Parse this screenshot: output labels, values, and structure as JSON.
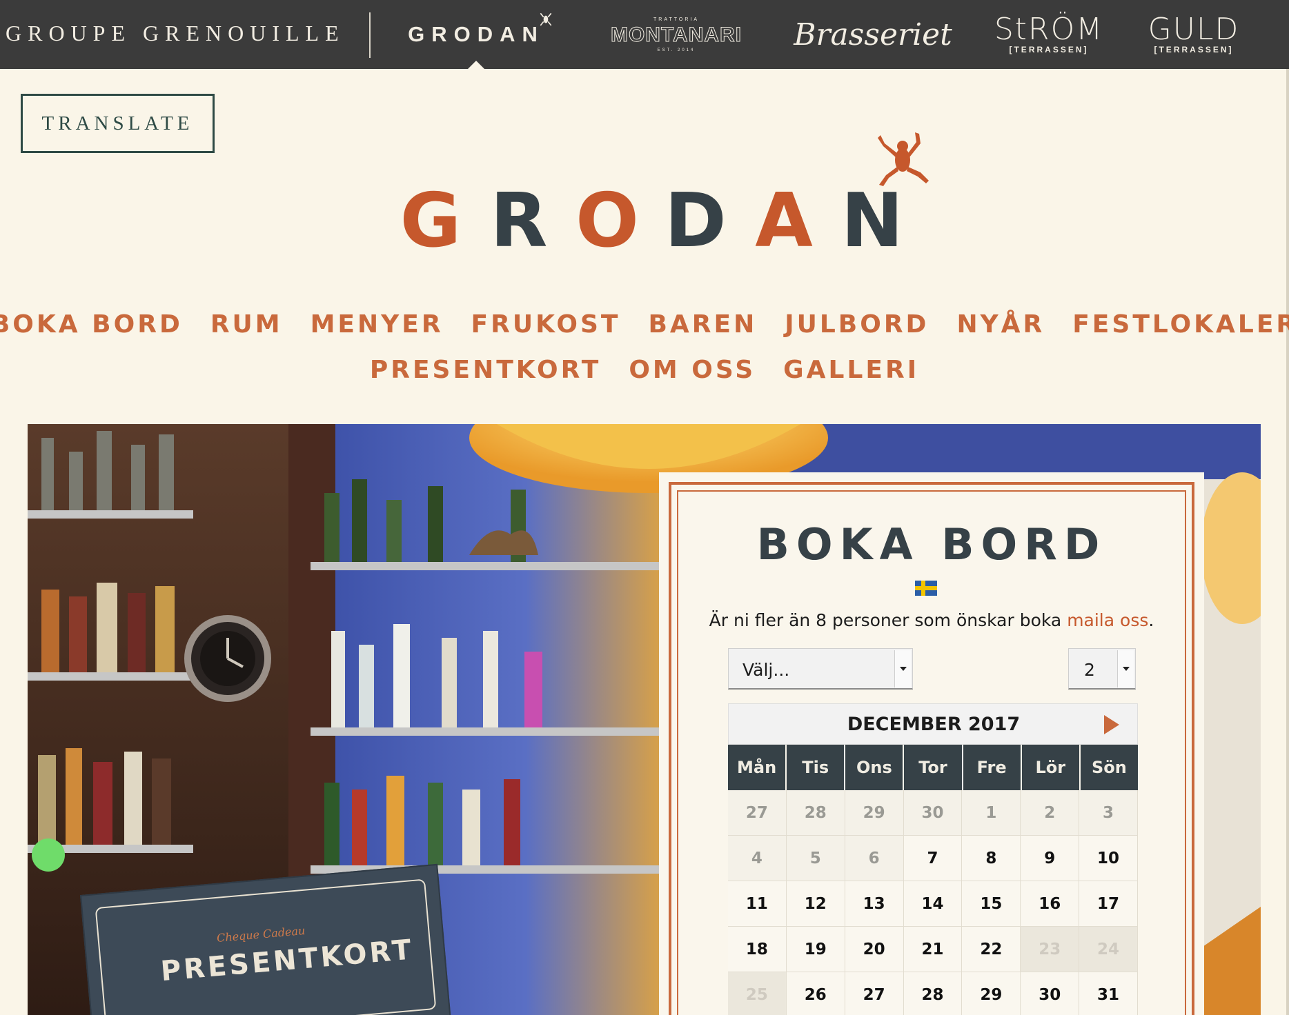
{
  "topbar": {
    "group_name": "GROUPE GRENOUILLE",
    "brands": [
      {
        "name": "GRODAN",
        "active": true
      },
      {
        "top": "TRATTORIA",
        "name": "MONTANARI",
        "est": "EST. 2014"
      },
      {
        "name": "Brasseriet"
      },
      {
        "name": "StRÖM",
        "sub": "[TERRASSEN]"
      },
      {
        "name": "GULD",
        "sub": "[TERRASSEN]"
      }
    ]
  },
  "translate_label": "TRANSLATE",
  "logo_letters": [
    "G",
    "R",
    "O",
    "D",
    "A",
    "N"
  ],
  "nav": {
    "row1": [
      "BOKA BORD",
      "RUM",
      "MENYER",
      "FRUKOST",
      "BAREN",
      "JULBORD",
      "NYÅR",
      "FESTLOKALER"
    ],
    "row2": [
      "PRESENTKORT",
      "OM OSS",
      "GALLERI"
    ]
  },
  "gift_card": {
    "script": "Cheque Cadeau",
    "title": "PRESENTKORT"
  },
  "booking": {
    "title": "BOKA BORD",
    "info_text": "Är ni fler än 8 personer som önskar boka ",
    "info_link": "maila oss",
    "info_end": ".",
    "restaurant_select": "Välj...",
    "people_select": "2",
    "calendar": {
      "month_label": "DECEMBER 2017",
      "weekdays": [
        "Mån",
        "Tis",
        "Ons",
        "Tor",
        "Fre",
        "Lör",
        "Sön"
      ],
      "days": [
        {
          "d": "27",
          "s": "past"
        },
        {
          "d": "28",
          "s": "past"
        },
        {
          "d": "29",
          "s": "past"
        },
        {
          "d": "30",
          "s": "past"
        },
        {
          "d": "1",
          "s": "past"
        },
        {
          "d": "2",
          "s": "past"
        },
        {
          "d": "3",
          "s": "past"
        },
        {
          "d": "4",
          "s": "past"
        },
        {
          "d": "5",
          "s": "past"
        },
        {
          "d": "6",
          "s": "past"
        },
        {
          "d": "7",
          "s": "avail"
        },
        {
          "d": "8",
          "s": "avail"
        },
        {
          "d": "9",
          "s": "avail"
        },
        {
          "d": "10",
          "s": "avail"
        },
        {
          "d": "11",
          "s": "avail"
        },
        {
          "d": "12",
          "s": "avail"
        },
        {
          "d": "13",
          "s": "avail"
        },
        {
          "d": "14",
          "s": "avail"
        },
        {
          "d": "15",
          "s": "avail"
        },
        {
          "d": "16",
          "s": "avail"
        },
        {
          "d": "17",
          "s": "avail"
        },
        {
          "d": "18",
          "s": "avail"
        },
        {
          "d": "19",
          "s": "avail"
        },
        {
          "d": "20",
          "s": "avail"
        },
        {
          "d": "21",
          "s": "avail"
        },
        {
          "d": "22",
          "s": "avail"
        },
        {
          "d": "23",
          "s": "closed"
        },
        {
          "d": "24",
          "s": "closed"
        },
        {
          "d": "25",
          "s": "closed"
        },
        {
          "d": "26",
          "s": "avail"
        },
        {
          "d": "27",
          "s": "avail"
        },
        {
          "d": "28",
          "s": "avail"
        },
        {
          "d": "29",
          "s": "avail"
        },
        {
          "d": "30",
          "s": "avail"
        },
        {
          "d": "31",
          "s": "avail"
        }
      ]
    }
  },
  "colors": {
    "accent": "#c9693c",
    "dark": "#364147",
    "background": "#faf5e8",
    "topbar": "#3b3b3b"
  }
}
